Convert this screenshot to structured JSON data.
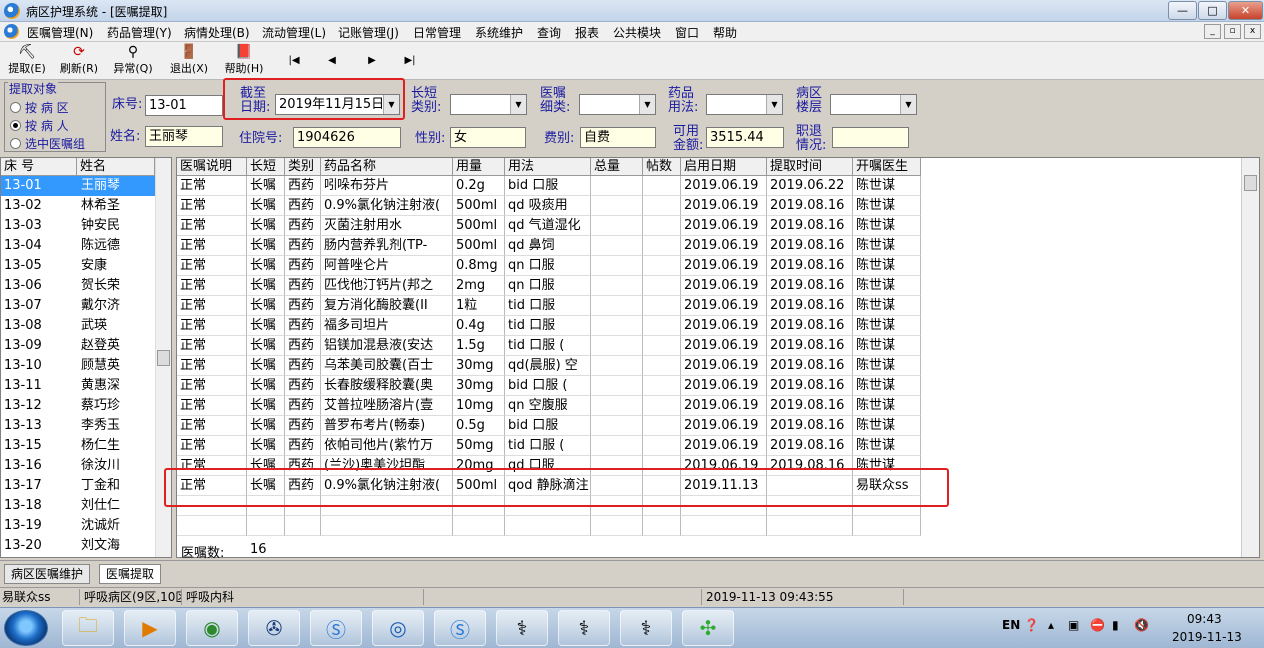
{
  "window": {
    "title": "病区护理系统 - [医嘱提取]",
    "min": "—",
    "max": "□",
    "close": "✕"
  },
  "menu": [
    "医嘱管理(N)",
    "药品管理(Y)",
    "病情处理(B)",
    "流动管理(L)",
    "记账管理(J)",
    "日常管理",
    "系统维护",
    "查询",
    "报表",
    "公共模块",
    "窗口",
    "帮助"
  ],
  "mdi": {
    "min": "_",
    "restore": "▫",
    "close": "x"
  },
  "toolbar": {
    "extract": "提取(E)",
    "refresh": "刷新(R)",
    "abnormal": "异常(Q)",
    "exit": "退出(X)",
    "help": "帮助(H)"
  },
  "nav": {
    "first": "|◀",
    "prev": "◀",
    "next": "▶",
    "last": "▶|"
  },
  "filter": {
    "legend": "提取对象",
    "opt1": "按 病 区",
    "opt2": "按 病 人",
    "opt3": "选中医嘱组",
    "selected": 2
  },
  "form": {
    "bed_label": "床号:",
    "bed_value": "13-01",
    "name_label": "姓名:",
    "name_value": "王丽琴",
    "deadline_label1": "截至",
    "deadline_label2": "日期:",
    "deadline_value": "2019年11月15日",
    "term_label1": "长短",
    "term_label2": "类别:",
    "term_value": "",
    "detail_label1": "医嘱",
    "detail_label2": "细类:",
    "detail_value": "",
    "usage_label1": "药品",
    "usage_label2": "用法:",
    "usage_value": "",
    "ward_label1": "病区",
    "ward_label2": "楼层",
    "ward_value": "",
    "adm_label": "住院号:",
    "adm_value": "1904626",
    "sex_label": "性别:",
    "sex_value": "女",
    "fee_label": "费别:",
    "fee_value": "自费",
    "amt_label1": "可用",
    "amt_label2": "金额:",
    "amt_value": "3515.44",
    "retire_label1": "职退",
    "retire_label2": "情况:",
    "retire_value": ""
  },
  "beds": {
    "headers": [
      "床 号",
      "姓名"
    ],
    "rows": [
      [
        "13-01",
        "王丽琴"
      ],
      [
        "13-02",
        "林希圣"
      ],
      [
        "13-03",
        "钟安民"
      ],
      [
        "13-04",
        "陈远德"
      ],
      [
        "13-05",
        "安康"
      ],
      [
        "13-06",
        "贺长荣"
      ],
      [
        "13-07",
        "戴尔济"
      ],
      [
        "13-08",
        "武瑛"
      ],
      [
        "13-09",
        "赵登英"
      ],
      [
        "13-10",
        "顾慧英"
      ],
      [
        "13-11",
        "黄惠深"
      ],
      [
        "13-12",
        "蔡巧珍"
      ],
      [
        "13-13",
        "李秀玉"
      ],
      [
        "13-15",
        "杨仁生"
      ],
      [
        "13-16",
        "徐汝川"
      ],
      [
        "13-17",
        "丁金和"
      ],
      [
        "13-18",
        "刘仕仁"
      ],
      [
        "13-19",
        "沈诚炘"
      ],
      [
        "13-20",
        "刘文海"
      ]
    ]
  },
  "orders": {
    "headers": [
      "医嘱说明",
      "长短",
      "类别",
      "药品名称",
      "用量",
      "用法",
      "总量",
      "帖数",
      "启用日期",
      "提取时间",
      "开嘱医生"
    ],
    "rows": [
      [
        "正常",
        "长嘱",
        "西药",
        "吲哚布芬片",
        "0.2g",
        "bid 口服",
        "",
        "",
        "2019.06.19",
        "2019.06.22",
        "陈世谋"
      ],
      [
        "正常",
        "长嘱",
        "西药",
        "0.9%氯化钠注射液(",
        "500ml",
        "qd 吸痰用",
        "",
        "",
        "2019.06.19",
        "2019.08.16",
        "陈世谋"
      ],
      [
        "正常",
        "长嘱",
        "西药",
        "灭菌注射用水",
        "500ml",
        "qd 气道湿化",
        "",
        "",
        "2019.06.19",
        "2019.08.16",
        "陈世谋"
      ],
      [
        "正常",
        "长嘱",
        "西药",
        "肠内营养乳剂(TP-",
        "500ml",
        "qd 鼻饲",
        "",
        "",
        "2019.06.19",
        "2019.08.16",
        "陈世谋"
      ],
      [
        "正常",
        "长嘱",
        "西药",
        "阿普唑仑片",
        "0.8mg",
        "qn 口服",
        "",
        "",
        "2019.06.19",
        "2019.08.16",
        "陈世谋"
      ],
      [
        "正常",
        "长嘱",
        "西药",
        "匹伐他汀钙片(邦之",
        "2mg",
        "qn 口服",
        "",
        "",
        "2019.06.19",
        "2019.08.16",
        "陈世谋"
      ],
      [
        "正常",
        "长嘱",
        "西药",
        "复方消化酶胶囊(II",
        "1粒",
        "tid 口服",
        "",
        "",
        "2019.06.19",
        "2019.08.16",
        "陈世谋"
      ],
      [
        "正常",
        "长嘱",
        "西药",
        "福多司坦片",
        "0.4g",
        "tid 口服",
        "",
        "",
        "2019.06.19",
        "2019.08.16",
        "陈世谋"
      ],
      [
        "正常",
        "长嘱",
        "西药",
        "铝镁加混悬液(安达",
        "1.5g",
        "tid 口服 (",
        "",
        "",
        "2019.06.19",
        "2019.08.16",
        "陈世谋"
      ],
      [
        "正常",
        "长嘱",
        "西药",
        "乌苯美司胶囊(百士",
        "30mg",
        "qd(晨服) 空",
        "",
        "",
        "2019.06.19",
        "2019.08.16",
        "陈世谋"
      ],
      [
        "正常",
        "长嘱",
        "西药",
        "长春胺缓释胶囊(奥",
        "30mg",
        "bid 口服 (",
        "",
        "",
        "2019.06.19",
        "2019.08.16",
        "陈世谋"
      ],
      [
        "正常",
        "长嘱",
        "西药",
        "艾普拉唑肠溶片(壹",
        "10mg",
        "qn 空腹服",
        "",
        "",
        "2019.06.19",
        "2019.08.16",
        "陈世谋"
      ],
      [
        "正常",
        "长嘱",
        "西药",
        "普罗布考片(畅泰)",
        "0.5g",
        "bid 口服",
        "",
        "",
        "2019.06.19",
        "2019.08.16",
        "陈世谋"
      ],
      [
        "正常",
        "长嘱",
        "西药",
        "依帕司他片(紫竹万",
        "50mg",
        "tid 口服 (",
        "",
        "",
        "2019.06.19",
        "2019.08.16",
        "陈世谋"
      ],
      [
        "正常",
        "长嘱",
        "西药",
        "(兰沙)奥美沙坦酯",
        "20mg",
        "qd 口服",
        "",
        "",
        "2019.06.19",
        "2019.08.16",
        "陈世谋"
      ],
      [
        "正常",
        "长嘱",
        "西药",
        "0.9%氯化钠注射液(",
        "500ml",
        "qod 静脉滴注",
        "",
        "",
        "2019.11.13",
        "",
        "易联众ss"
      ]
    ],
    "count_label": "医嘱数:",
    "count_value": "16"
  },
  "tabs": [
    "病区医嘱维护",
    "医嘱提取"
  ],
  "status": [
    "易联众ss",
    "呼吸病区(9区,10区",
    "呼吸内科",
    "",
    "2019-11-13 09:43:55"
  ],
  "tray": {
    "lang": "EN",
    "time": "09:43",
    "date": "2019-11-13"
  },
  "colors": {
    "selection": "#3399ff",
    "highlight_box": "#e02020",
    "label": "#1a1aa0",
    "field_bg": "#ffffe6"
  }
}
